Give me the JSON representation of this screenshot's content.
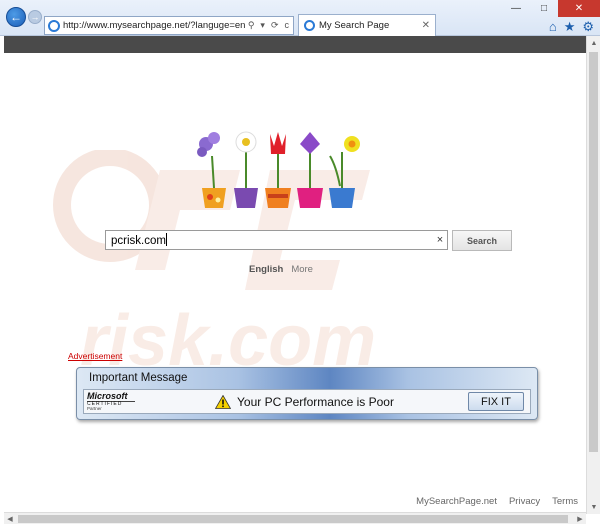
{
  "browser": {
    "url": "http://www.mysearchpage.net/?languge=en",
    "tab_title": "My Search Page",
    "address_tools": [
      "⚲",
      "▾",
      "⟳",
      "c"
    ],
    "window_controls": {
      "minimize": "—",
      "maximize": "□",
      "close": "✕"
    }
  },
  "watermark": {
    "text": "risk.com"
  },
  "search": {
    "value": "pcrisk.com",
    "clear_label": "×",
    "button_label": "Search"
  },
  "languages": {
    "active": "English",
    "more": "More"
  },
  "ad": {
    "label": "Advertisement",
    "title": "Important Message",
    "logo_top": "Microsoft",
    "logo_middle": "CERTIFIED",
    "logo_bottom": "Partner",
    "message": "Your PC Performance is Poor",
    "button_label": "FIX IT"
  },
  "footer": {
    "site": "MySearchPage.net",
    "privacy": "Privacy",
    "terms": "Terms"
  },
  "colors": {
    "chrome_accent": "#1c5fb8",
    "dark_bar": "#4a4a4a",
    "ad_link": "#cc0000",
    "close_button": "#c7382e"
  }
}
